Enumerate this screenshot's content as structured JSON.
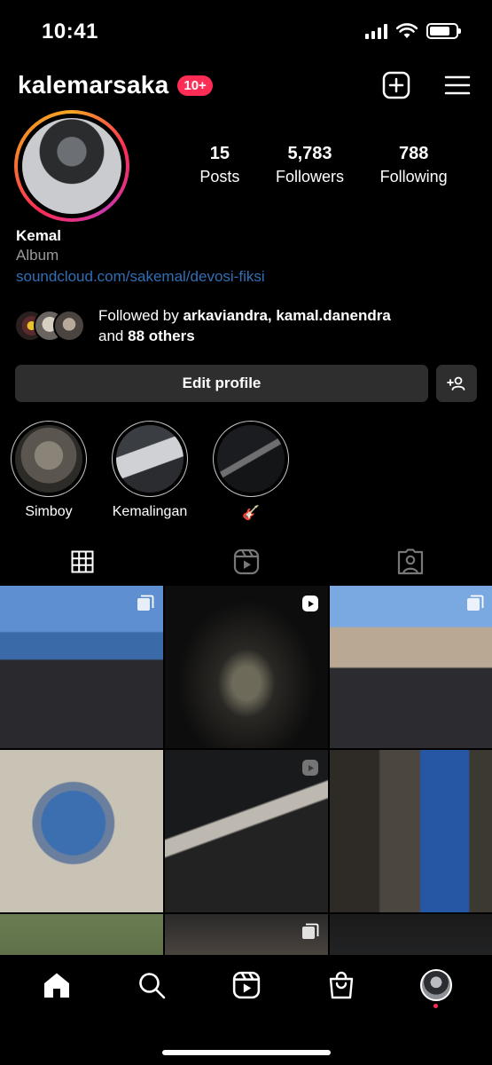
{
  "status_bar": {
    "time": "10:41"
  },
  "header": {
    "username": "kalemarsaka",
    "notification_badge": "10+"
  },
  "stats": [
    {
      "value": "15",
      "label": "Posts"
    },
    {
      "value": "5,783",
      "label": "Followers"
    },
    {
      "value": "788",
      "label": "Following"
    }
  ],
  "bio": {
    "name": "Kemal",
    "category": "Album",
    "link": "soundcloud.com/sakemal/devosi-fiksi"
  },
  "followed_by": {
    "prefix": "Followed by",
    "names": "arkaviandra, kamal.danendra",
    "and": "and",
    "others": "88 others"
  },
  "buttons": {
    "edit_profile": "Edit profile"
  },
  "highlights": [
    {
      "label": "Simboy"
    },
    {
      "label": "Kemalingan"
    },
    {
      "label": "🎸"
    }
  ],
  "colors": {
    "accent": "#ff2d55",
    "link": "#2f6fb5",
    "button_bg": "#2e2e2e"
  }
}
